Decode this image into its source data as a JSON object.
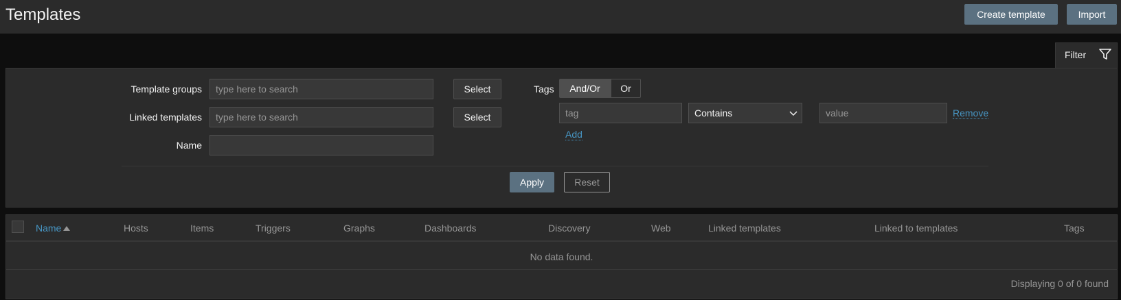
{
  "header": {
    "title": "Templates",
    "create_label": "Create template",
    "import_label": "Import"
  },
  "filter": {
    "tab_label": "Filter",
    "template_groups_label": "Template groups",
    "template_groups_placeholder": "type here to search",
    "linked_templates_label": "Linked templates",
    "linked_templates_placeholder": "type here to search",
    "select_label": "Select",
    "name_label": "Name",
    "name_value": "",
    "tags_label": "Tags",
    "tags_and_or": "And/Or",
    "tags_or": "Or",
    "tag_placeholder": "tag",
    "operator_selected": "Contains",
    "value_placeholder": "value",
    "remove_label": "Remove",
    "add_label": "Add",
    "apply_label": "Apply",
    "reset_label": "Reset"
  },
  "table": {
    "columns": [
      "Name",
      "Hosts",
      "Items",
      "Triggers",
      "Graphs",
      "Dashboards",
      "Discovery",
      "Web",
      "Linked templates",
      "Linked to templates",
      "Tags"
    ],
    "sort_column": "Name",
    "sort_direction": "ascending",
    "empty_message": "No data found.",
    "footer": "Displaying 0 of 0 found"
  },
  "colors": {
    "accent": "#4796c4",
    "button": "#5b7181",
    "panel": "#2b2b2b"
  }
}
